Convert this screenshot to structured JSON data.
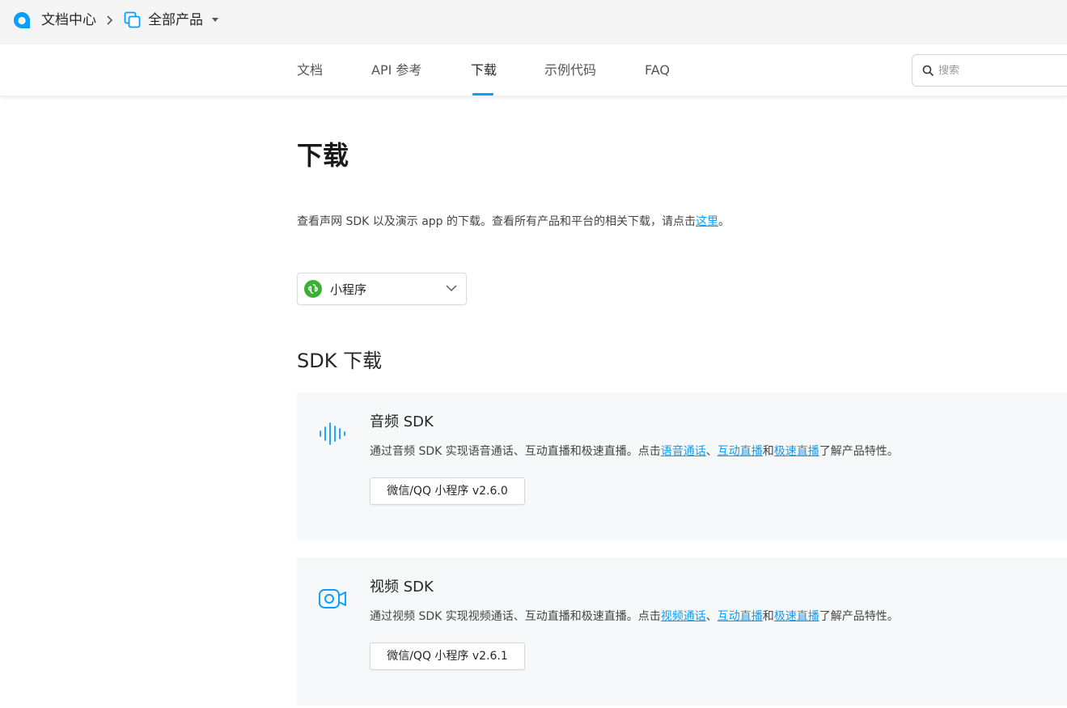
{
  "topbar": {
    "doc_center": "文档中心",
    "products": "全部产品"
  },
  "nav": {
    "items": [
      {
        "label": "文档"
      },
      {
        "label": "API 参考"
      },
      {
        "label": "下载"
      },
      {
        "label": "示例代码"
      },
      {
        "label": "FAQ"
      }
    ],
    "active_index": 2,
    "search_placeholder": "搜索"
  },
  "page": {
    "title": "下载",
    "intro_text": "查看声网 SDK 以及演示 app 的下载。查看所有产品和平台的相关下载，请点击",
    "intro_link": "这里",
    "intro_end": "。",
    "platform": "小程序",
    "section_title": "SDK 下载"
  },
  "cards": [
    {
      "title": "音频 SDK",
      "desc_prefix": "通过音频 SDK 实现语音通话、互动直播和极速直播。点击",
      "link1": "语音通话",
      "sep1": "、",
      "link2": "互动直播",
      "sep2": "和",
      "link3": "极速直播",
      "desc_suffix": "了解产品特性。",
      "button": "微信/QQ 小程序 v2.6.0",
      "icon": "audio-waveform-icon"
    },
    {
      "title": "视频 SDK",
      "desc_prefix": "通过视频 SDK 实现视频通话、互动直播和极速直播。点击",
      "link1": "视频通话",
      "sep1": "、",
      "link2": "互动直播",
      "sep2": "和",
      "link3": "极速直播",
      "desc_suffix": "了解产品特性。",
      "button": "微信/QQ 小程序 v2.6.1",
      "icon": "video-camera-icon"
    }
  ],
  "colors": {
    "accent": "#099dfd",
    "miniprogram_green": "#3cb034",
    "card_bg": "#f7f8fa"
  }
}
